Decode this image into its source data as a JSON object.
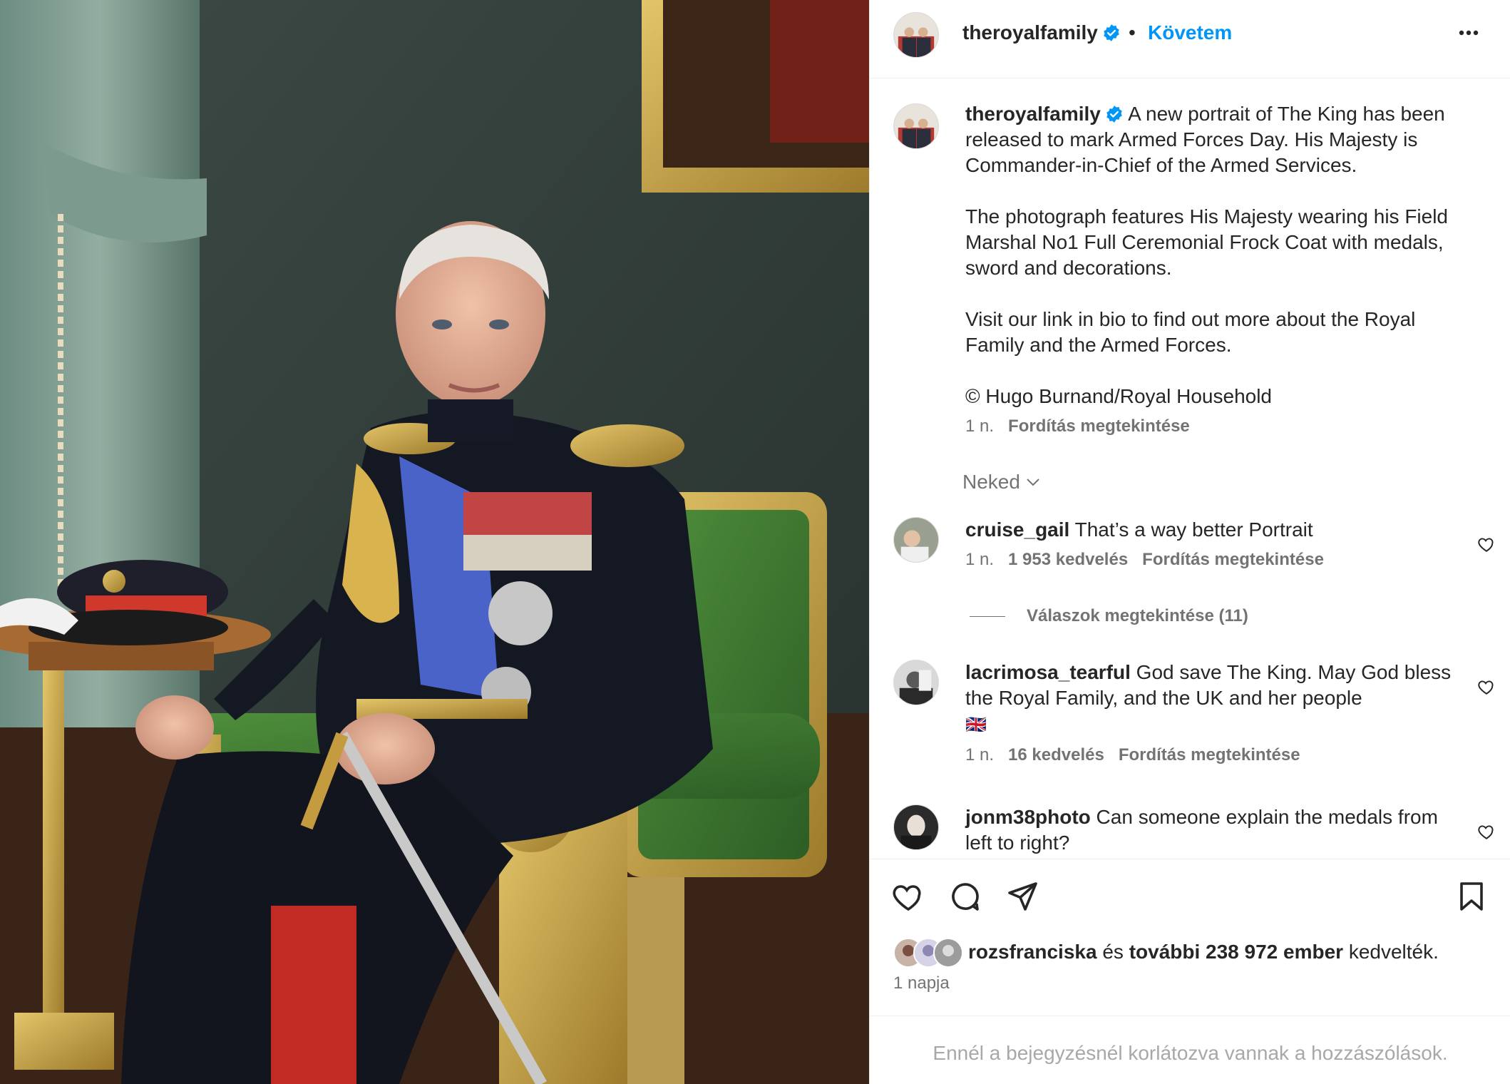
{
  "header": {
    "username": "theroyalfamily",
    "separator": "•",
    "follow_label": "Követem",
    "more_icon": "more-horizontal-icon"
  },
  "caption": {
    "username": "theroyalfamily",
    "paragraphs": [
      "A new portrait of The King has been released to mark Armed Forces Day. His Majesty is Commander-in-Chief of the Armed Services.",
      "The photograph features His Majesty wearing his Field Marshal No1 Full Ceremonial Frock Coat with medals, sword and decorations.",
      "Visit our link in bio to find out more about the Royal Family and the Armed Forces.",
      "© Hugo Burnand/Royal Household"
    ],
    "time": "1 n.",
    "translate": "Fordítás megtekintése"
  },
  "sort_label": "Neked",
  "comments": [
    {
      "username": "cruise_gail",
      "text": "That’s a way better Portrait",
      "time": "1 n.",
      "likes": "1 953 kedvelés",
      "translate": "Fordítás megtekintése",
      "replies": "Válaszok megtekintése (11)"
    },
    {
      "username": "lacrimosa_tearful",
      "text": "God save The King. May God bless the Royal Family, and the UK and her people",
      "flag": "🇬🇧",
      "time": "1 n.",
      "likes": "16 kedvelés",
      "translate": "Fordítás megtekintése"
    },
    {
      "username": "jonm38photo",
      "text": "Can someone explain the medals from left to right?"
    }
  ],
  "likes": {
    "user": "rozsfranciska",
    "and": "és",
    "others": "további 238 972 ember",
    "suffix": "kedvelték."
  },
  "post_date": "1 napja",
  "footer_text": "Ennél a bejegyzésnél korlátozva vannak a hozzászólások.",
  "colors": {
    "accent": "#0095f6",
    "text": "#262626",
    "secondary": "#737373"
  }
}
